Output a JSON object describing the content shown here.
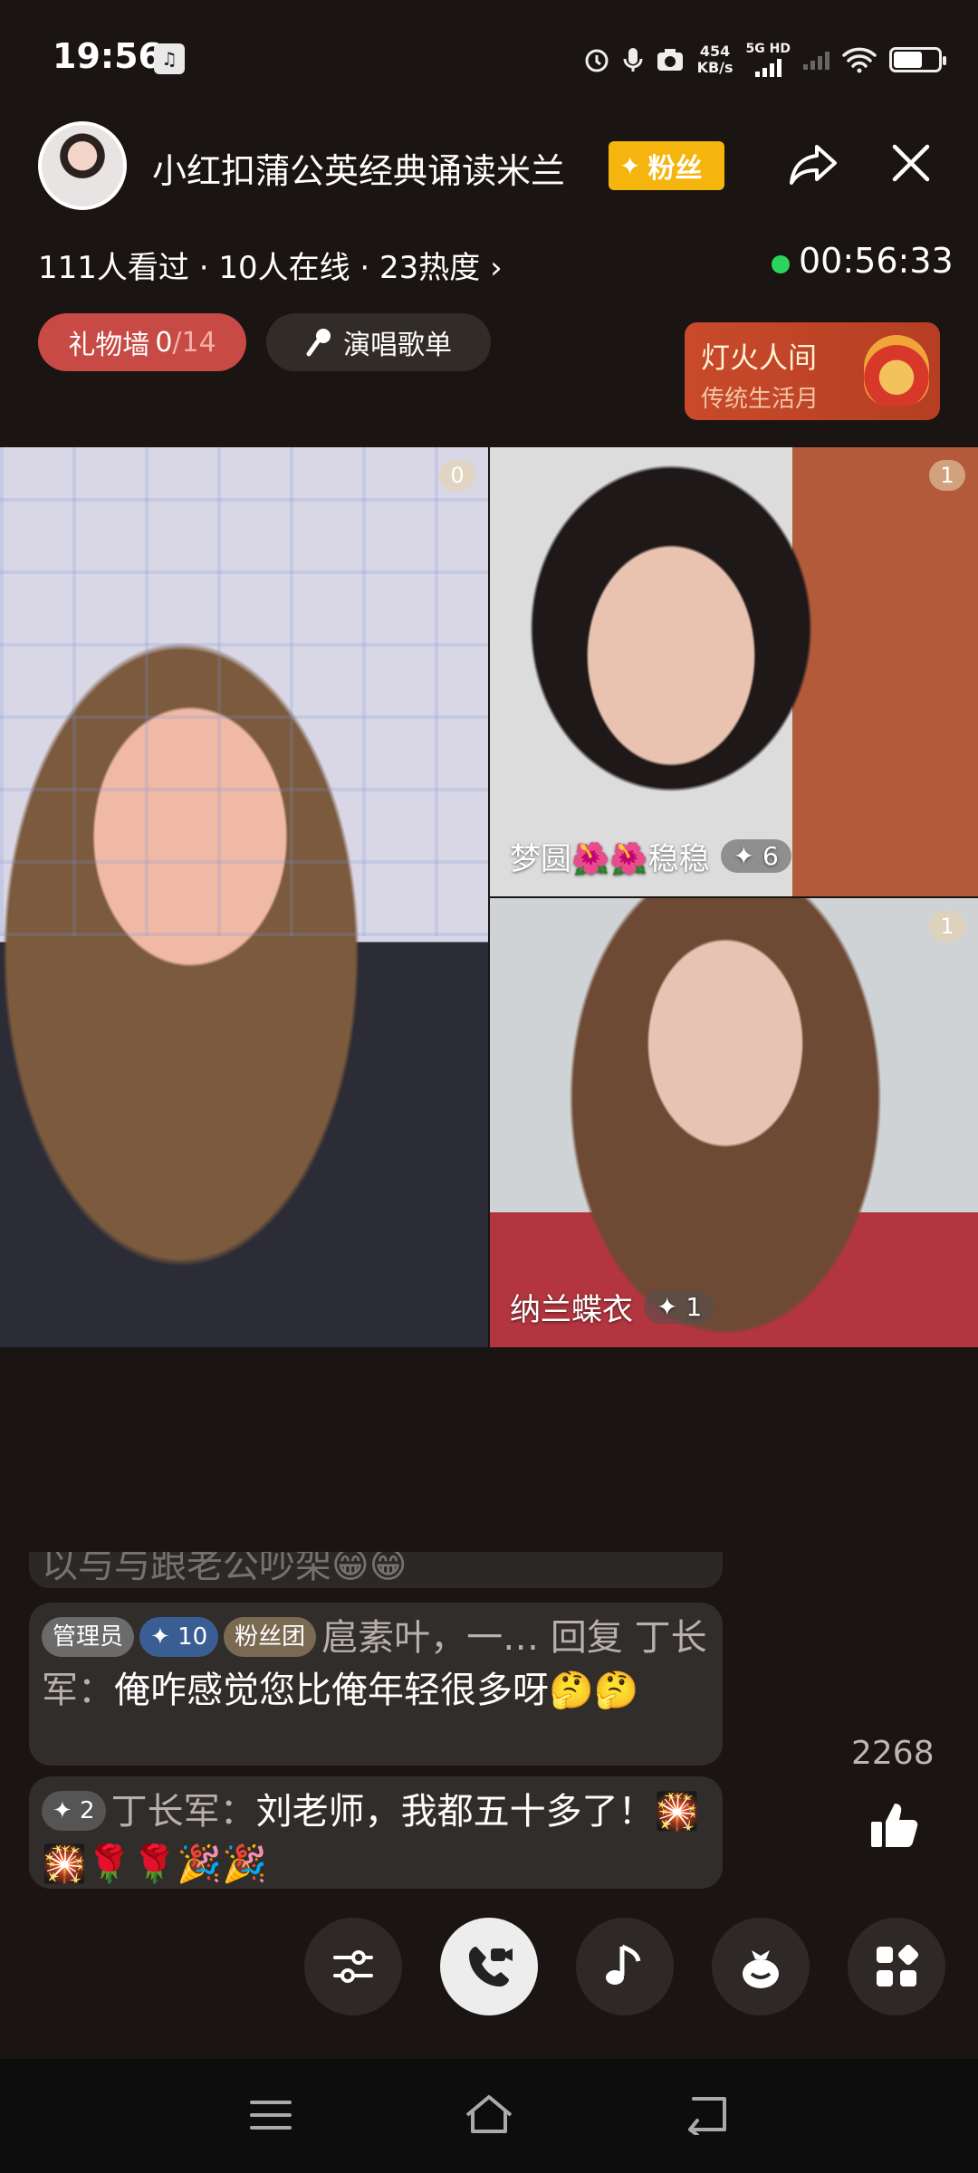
{
  "status_bar": {
    "time": "19:56",
    "net_speed_value": "454",
    "net_speed_unit": "KB/s",
    "net_type": "5G HD"
  },
  "header": {
    "room_title": "小红扣蒲公英经典诵读米兰",
    "fan_badge_label": "粉丝",
    "viewer_stats": "111人看过 · 10人在线 · 23热度 ›",
    "live_timer": "00:56:33"
  },
  "toolbar": {
    "gift_wall_label": "礼物墙",
    "gift_wall_count": "0",
    "gift_wall_total": "/14",
    "song_list_label": "演唱歌单"
  },
  "promo": {
    "title": "灯火人间",
    "subtitle": "传统生活月"
  },
  "tiles": {
    "main": {
      "seat_count": "0"
    },
    "top_right": {
      "seat_count": "1",
      "name": "梦圆🌺🌺稳稳",
      "level": "✦ 6"
    },
    "bottom_right": {
      "seat_count": "1",
      "name": "纳兰蝶衣",
      "level": "✦ 1"
    }
  },
  "chat": {
    "partial_message": "以与与跟老公吵架😁😁",
    "messages": [
      {
        "tags": [
          "管理员",
          "✦ 10",
          "粉丝团"
        ],
        "user": "扈素叶，一… 回复 丁长军：",
        "text": "俺咋感觉您比俺年轻很多呀🤔🤔"
      },
      {
        "tags": [
          "✦ 2"
        ],
        "user": "丁长军：",
        "text": "刘老师，我都五十多了！🎇🎇🌹🌹🎉🎉"
      }
    ]
  },
  "like": {
    "count": "2268"
  },
  "colors": {
    "fan_badge": "#f6b40e",
    "gift_wall": "#c84a44",
    "live_dot": "#2bd45c",
    "promo": "#c94a2b"
  },
  "icons": {
    "bottom_actions": [
      "sliders-icon",
      "video-call-icon",
      "music-note-icon",
      "gift-bag-icon",
      "apps-grid-icon"
    ],
    "nav": [
      "menu-icon",
      "home-icon",
      "back-icon"
    ]
  }
}
